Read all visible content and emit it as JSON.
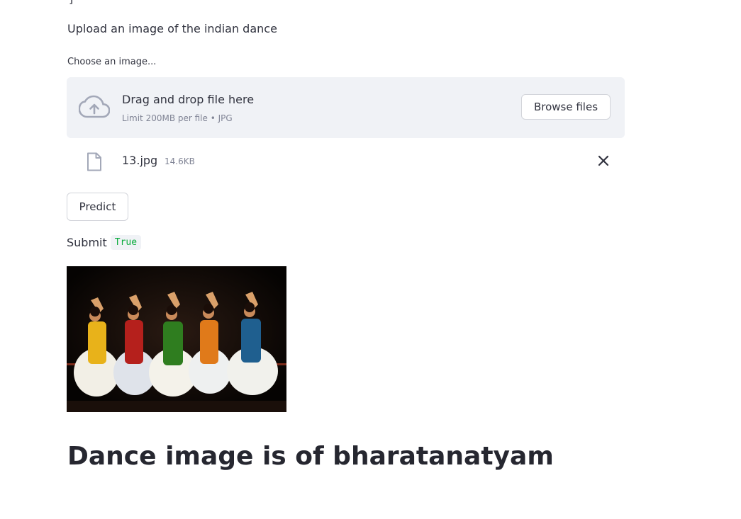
{
  "top_fragment": "]",
  "upload_prompt": "Upload an image of the indian dance",
  "uploader": {
    "label": "Choose an image...",
    "drag_text": "Drag and drop file here",
    "limit_text": "Limit 200MB per file • JPG",
    "browse_label": "Browse files",
    "icon": "cloud-upload-icon"
  },
  "uploaded_file": {
    "name": "13.jpg",
    "size": "14.6KB",
    "icon": "file-icon",
    "remove_icon": "close-icon"
  },
  "predict_label": "Predict",
  "submit": {
    "label": "Submit",
    "value": "True",
    "value_color": "#09ab3b"
  },
  "result_heading": "Dance image is of bharatanatyam",
  "colors": {
    "text": "#31333f",
    "muted": "#808495",
    "dropzone_bg": "#f0f2f6",
    "border": "#d2d4da"
  }
}
